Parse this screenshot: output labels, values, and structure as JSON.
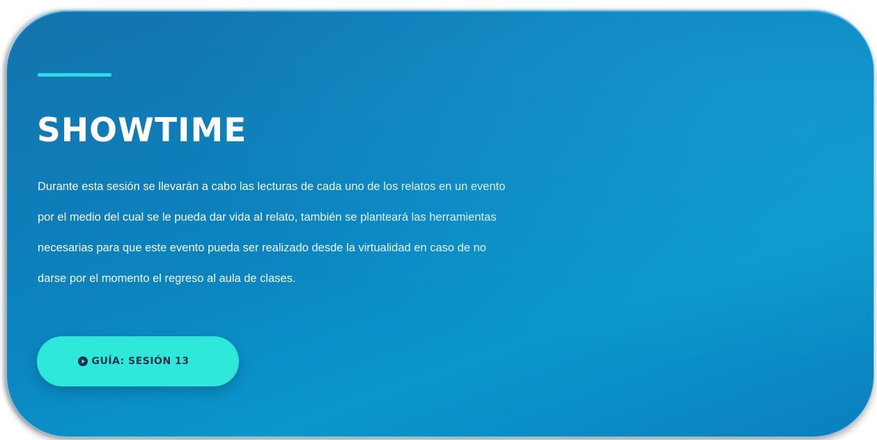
{
  "section": {
    "title": "SHOWTIME",
    "description": "Durante esta sesión se llevarán a cabo las lecturas de cada uno de los relatos en un evento por el medio del cual se le pueda dar vida al relato, también se planteará las herramientas necesarias para que este evento pueda ser realizado desde la virtualidad en caso de no darse por el momento el regreso al aula de clases."
  },
  "button": {
    "label": "GUÍA: SESIÓN 13",
    "icon": "play-circle-icon"
  },
  "colors": {
    "accent": "#2ed9e3",
    "button_bg": "#2ee8d9",
    "card_bg": "#0b84c0",
    "button_text": "#1e2f4a"
  }
}
